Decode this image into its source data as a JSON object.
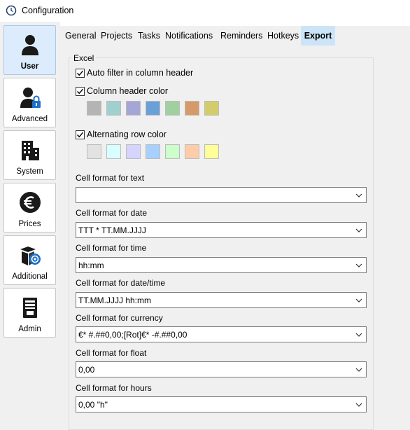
{
  "window": {
    "title": "Configuration"
  },
  "sidebar": {
    "items": [
      {
        "label": "User",
        "icon": "user-icon",
        "active": true
      },
      {
        "label": "Advanced",
        "icon": "user-lock-icon",
        "active": false
      },
      {
        "label": "System",
        "icon": "building-icon",
        "active": false
      },
      {
        "label": "Prices",
        "icon": "euro-icon",
        "active": false
      },
      {
        "label": "Additional",
        "icon": "box-icon",
        "active": false
      },
      {
        "label": "Admin",
        "icon": "server-icon",
        "active": false
      }
    ]
  },
  "tabs": [
    {
      "label": "General",
      "active": false
    },
    {
      "label": "Projects",
      "active": false
    },
    {
      "label": "Tasks",
      "active": false
    },
    {
      "label": "Notifications",
      "active": false
    },
    {
      "label": "Reminders",
      "active": false
    },
    {
      "label": "Hotkeys",
      "active": false
    },
    {
      "label": "Export",
      "active": true
    }
  ],
  "excel": {
    "group_title": "Excel",
    "auto_filter": {
      "label": "Auto filter in column header",
      "checked": true
    },
    "header_color": {
      "label": "Column header color",
      "checked": true,
      "swatches": [
        "#b4b4b4",
        "#9fd0d0",
        "#a5a5d8",
        "#6a9fd8",
        "#a0d0a0",
        "#d49a6a",
        "#d4cc6a"
      ]
    },
    "alt_row_color": {
      "label": "Alternating row color",
      "checked": true,
      "swatches": [
        "#e2e2e2",
        "#d8ffff",
        "#d4d4ff",
        "#a8d0ff",
        "#ccffcc",
        "#ffccaa",
        "#ffff99"
      ]
    },
    "fields": [
      {
        "label": "Cell format for text",
        "value": ""
      },
      {
        "label": "Cell format for date",
        "value": "TTT * TT.MM.JJJJ"
      },
      {
        "label": "Cell format for time",
        "value": "hh:mm"
      },
      {
        "label": "Cell format for date/time",
        "value": "TT.MM.JJJJ hh:mm"
      },
      {
        "label": "Cell format for currency",
        "value": "€* #.##0,00;[Rot]€* -#.##0,00"
      },
      {
        "label": "Cell format for float",
        "value": "0,00"
      },
      {
        "label": "Cell format for hours",
        "value": "0,00 \"h\""
      }
    ]
  },
  "colors": {
    "accent_tab": "#cce4f7",
    "active_side": "#dcecfc"
  }
}
